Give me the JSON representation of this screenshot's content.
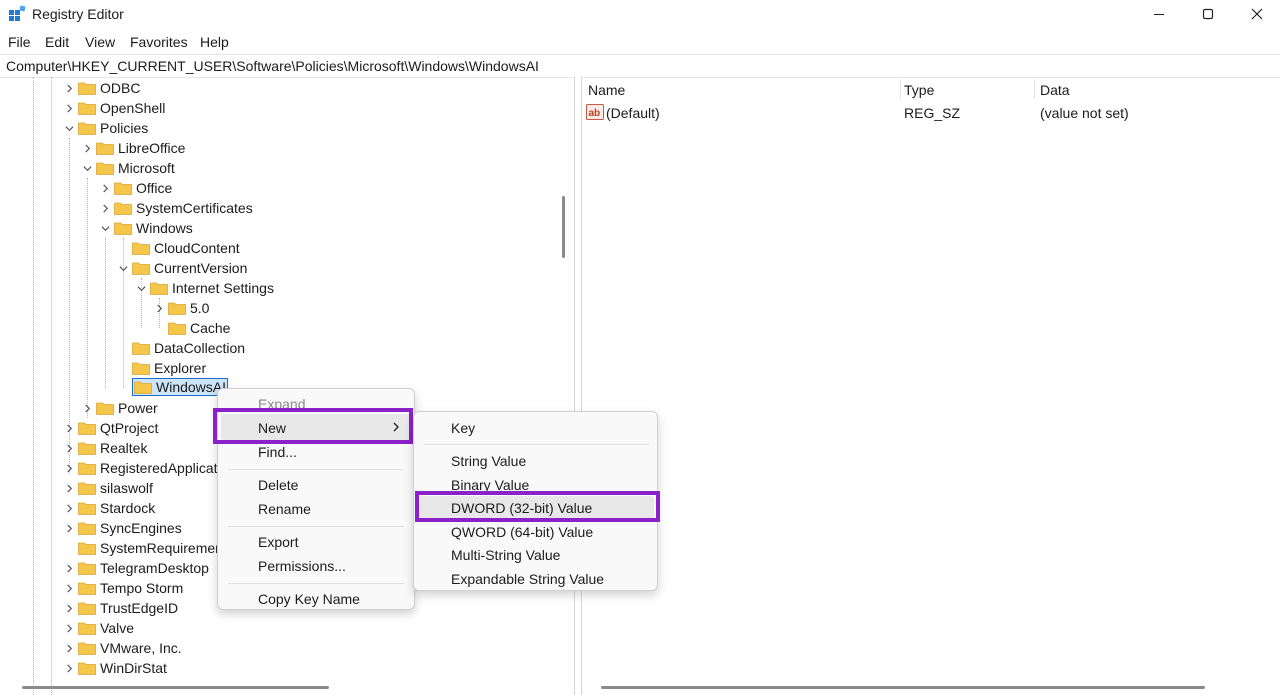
{
  "window": {
    "title": "Registry Editor",
    "controls": {
      "minimize": "minimize",
      "maximize": "maximize",
      "close": "close"
    }
  },
  "menu": [
    "File",
    "Edit",
    "View",
    "Favorites",
    "Help"
  ],
  "address": "Computer\\HKEY_CURRENT_USER\\Software\\Policies\\Microsoft\\Windows\\WindowsAI",
  "tree": {
    "odbc": "ODBC",
    "openshell": "OpenShell",
    "policies": "Policies",
    "libreoffice": "LibreOffice",
    "microsoft": "Microsoft",
    "office": "Office",
    "systemcertificates": "SystemCertificates",
    "windows": "Windows",
    "cloudcontent": "CloudContent",
    "currentversion": "CurrentVersion",
    "internetsettings": "Internet Settings",
    "five": "5.0",
    "cache": "Cache",
    "datacollection": "DataCollection",
    "explorer": "Explorer",
    "windowsai": "WindowsAI",
    "power": "Power",
    "qtproject": "QtProject",
    "realtek": "Realtek",
    "registeredapplications": "RegisteredApplicati",
    "silaswolf": "silaswolf",
    "stardock": "Stardock",
    "syncengines": "SyncEngines",
    "systemrequirements": "SystemRequirement",
    "telegramdesktop": "TelegramDesktop",
    "tempostorm": "Tempo Storm",
    "trustedgeid": "TrustEdgeID",
    "valve": "Valve",
    "vmware": "VMware, Inc.",
    "windirstat": "WinDirStat"
  },
  "list": {
    "headers": {
      "name": "Name",
      "type": "Type",
      "data": "Data"
    },
    "rows": [
      {
        "name": "(Default)",
        "type": "REG_SZ",
        "data": "(value not set)",
        "icon": "ab-string-icon"
      }
    ]
  },
  "context_menu": {
    "expand": "Expand",
    "new": "New",
    "find": "Find...",
    "delete": "Delete",
    "rename": "Rename",
    "export": "Export",
    "permissions": "Permissions...",
    "copy_key_name": "Copy Key Name"
  },
  "submenu": {
    "key": "Key",
    "string_value": "String Value",
    "binary_value": "Binary Value",
    "dword_value": "DWORD (32-bit) Value",
    "qword_value": "QWORD (64-bit) Value",
    "multi_string_value": "Multi-String Value",
    "expandable_string_value": "Expandable String Value"
  },
  "colors": {
    "highlight": "#8b22c9",
    "folder": "#f6c64b",
    "selection": "#cce4f7"
  }
}
